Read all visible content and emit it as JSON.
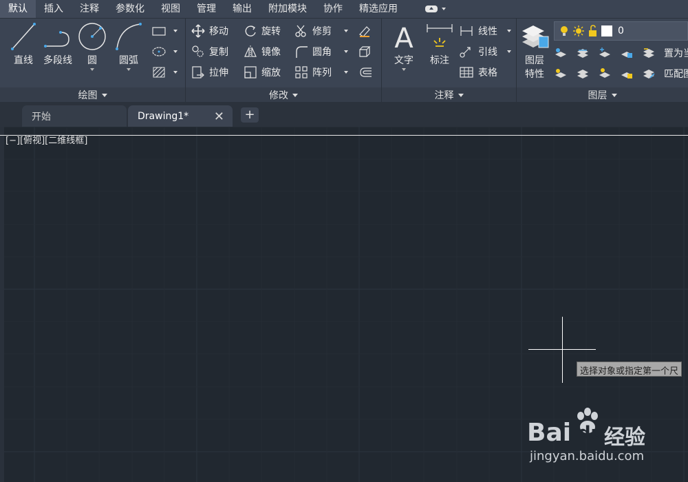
{
  "menu": {
    "tabs": [
      "默认",
      "插入",
      "注释",
      "参数化",
      "视图",
      "管理",
      "输出",
      "附加模块",
      "协作",
      "精选应用"
    ]
  },
  "ribbon": {
    "draw": {
      "title": "绘图",
      "line": "直线",
      "polyline": "多段线",
      "circle": "圆",
      "arc": "圆弧"
    },
    "modify": {
      "title": "修改",
      "move": "移动",
      "rotate": "旋转",
      "trim": "修剪",
      "copy": "复制",
      "mirror": "镜像",
      "fillet": "圆角",
      "stretch": "拉伸",
      "scale": "缩放",
      "array": "阵列"
    },
    "annotation": {
      "title": "注释",
      "text": "文字",
      "dimension": "标注",
      "linear": "线性",
      "leader": "引线",
      "table": "表格"
    },
    "layers": {
      "title": "图层",
      "properties_line1": "图层",
      "properties_line2": "特性",
      "current_layer": "0",
      "set_current": "置为当前",
      "match_layer": "匹配图层"
    }
  },
  "filetabs": {
    "start": "开始",
    "drawing": "Drawing1*",
    "close": "✕",
    "add": "+"
  },
  "viewport": {
    "label": "[−][俯视][二维线框]"
  },
  "tooltip": "选择对象或指定第一个尺",
  "watermark": {
    "brand": "Bai",
    "brand2": "du",
    "suffix": "经验",
    "url": "jingyan.baidu.com"
  },
  "colors": {
    "canvas": "#212830",
    "ribbon": "#3b4453",
    "accent": "#4aa8e8",
    "bulb": "#f2c81e"
  }
}
